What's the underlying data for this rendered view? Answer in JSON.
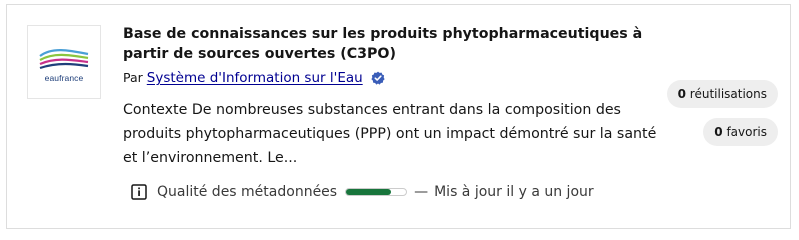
{
  "card": {
    "logo": {
      "text": "eaufrance",
      "colors": [
        "#4a9fd6",
        "#8bc53f",
        "#c7318a",
        "#1f3f7a"
      ]
    },
    "title": "Base de connaissances sur les produits phytopharmaceutiques à partir de sources ouvertes (C3PO)",
    "org_prefix": "Par",
    "org_name": "Système d'Information sur l'Eau",
    "org_verified_icon": "verified-badge-icon",
    "description": "Contexte De nombreuses substances entrant dans la composition des produits phytopharmaceutiques (PPP) ont un impact démontré sur la santé et l’environnement. Le...",
    "reuses": {
      "count": "0",
      "label": "réutilisations"
    },
    "favorites": {
      "count": "0",
      "label": "favoris"
    },
    "quality": {
      "label": "Qualité des métadonnées",
      "level": 0.75,
      "icon": "info-icon",
      "bar_color": "#18753c"
    },
    "separator": "—",
    "updated": "Mis à jour il y a un jour"
  }
}
